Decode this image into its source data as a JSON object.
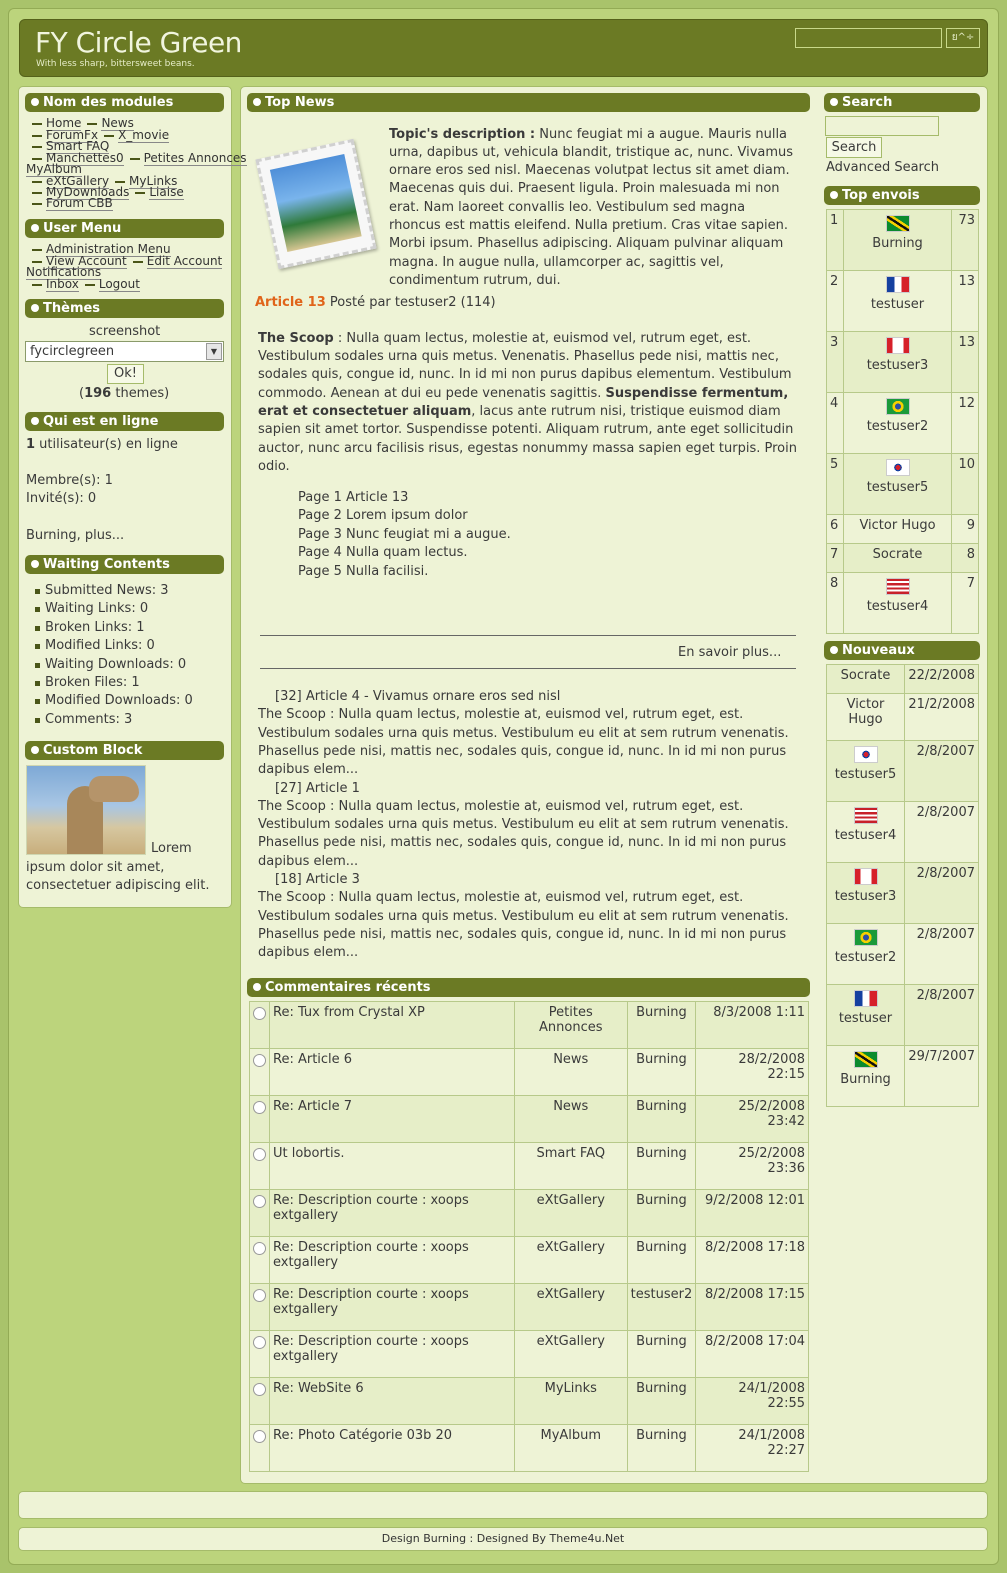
{
  "header": {
    "title": "FY Circle Green",
    "slogan": "With less sharp, bittersweet beans.",
    "search_button": "ย^÷"
  },
  "modules_block": {
    "title": "Nom des modules",
    "items": [
      "Home",
      "News",
      "ForumFx",
      "X_movie",
      "Smart FAQ",
      "Manchettes0",
      "Petites Annonces",
      "MyAlbum",
      "eXtGallery",
      "MyLinks",
      "MyDownloads",
      "Liaise",
      "Forum CBB"
    ]
  },
  "user_menu": {
    "title": "User Menu",
    "items": [
      "Administration Menu",
      "View Account",
      "Edit Account",
      "Notifications",
      "Inbox",
      "Logout"
    ]
  },
  "themes": {
    "title": "Thèmes",
    "screenshot_label": "screenshot",
    "selected": "fycirclegreen",
    "ok_button": "Ok!",
    "count_prefix": "(",
    "count": "196",
    "count_suffix": " themes)"
  },
  "online": {
    "title": "Qui est en ligne",
    "count": "1",
    "count_text": " utilisateur(s) en ligne",
    "members": "Membre(s): 1",
    "guests": "Invité(s): 0",
    "more": "Burning, plus..."
  },
  "waiting": {
    "title": "Waiting Contents",
    "items": [
      "Submitted News: 3",
      "Waiting Links: 0",
      "Broken Links: 1",
      "Modified Links: 0",
      "Waiting Downloads: 0",
      "Broken Files: 1",
      "Modified Downloads: 0",
      "Comments: 3"
    ]
  },
  "custom": {
    "title": "Custom Block",
    "text_1": "Lorem",
    "text_2": "ipsum dolor sit amet,",
    "text_3": "consectetuer adipiscing elit."
  },
  "top_news": {
    "title": "Top News",
    "topic_label": "Topic's description :",
    "topic_text": [
      " Nunc feugiat mi a augue. Mauris nulla",
      "urna, dapibus ut, vehicula blandit, tristique ac, nunc. Vivamus",
      "ornare eros sed nisl. Maecenas volutpat lectus sit amet diam.",
      "Maecenas quis dui. Praesent ligula. Proin malesuada mi non",
      "erat. Nam laoreet convallis leo. Vestibulum sed magna",
      "rhoncus est mattis eleifend. Nulla pretium. Cras vitae sapien.",
      "Morbi ipsum. Phasellus adipiscing. Aliquam pulvinar aliquam",
      "magna. In augue nulla, ullamcorper ac, sagittis vel,",
      "condimentum rutrum, dui."
    ],
    "article_label": "Article 13",
    "posted_by": " Posté par testuser2 (114)",
    "scoop_label": "The Scoop",
    "scoop_lines": [
      " : Nulla quam lectus, molestie at, euismod vel, rutrum eget, est.",
      "Vestibulum sodales urna quis metus. Venenatis. Phasellus pede nisi, mattis nec,",
      "sodales quis, congue id, nunc. In id mi non purus dapibus elementum. Vestibulum",
      "commodo. Aenean at dui eu pede venenatis sagittis. ",
      "lacus ante rutrum nisi, tristique euismod diam",
      "sapien sit amet tortor. Suspendisse potenti. Aliquam rutrum, ante eget sollicitudin",
      "auctor, nunc arcu facilisis risus, egestas nonummy massa sapien eget turpis. Proin",
      "odio."
    ],
    "scoop_bold_1": "Suspendisse fermentum,",
    "scoop_bold_2": "erat et consectetuer aliquam",
    "scoop_after_bold": ", lacus ante rutrum nisi, tristique euismod diam",
    "pages": [
      "Page 1 Article 13",
      "Page 2 Lorem ipsum dolor",
      "Page 3 Nunc feugiat mi a augue.",
      "Page 4 Nulla quam lectus.",
      "Page 5 Nulla facilisi."
    ],
    "read_more": "En savoir plus...",
    "others": [
      {
        "head": "[32] Article 4 - Vivamus ornare eros sed nisl",
        "lines": [
          "The Scoop : Nulla quam lectus, molestie at, euismod vel, rutrum eget, est.",
          "Vestibulum sodales urna quis metus. Vestibulum eu elit at sem rutrum venenatis.",
          "Phasellus pede nisi, mattis nec, sodales quis, congue id, nunc. In id mi non purus",
          "dapibus elem..."
        ]
      },
      {
        "head": "[27] Article 1",
        "lines": [
          "The Scoop : Nulla quam lectus, molestie at, euismod vel, rutrum eget, est.",
          "Vestibulum sodales urna quis metus. Vestibulum eu elit at sem rutrum venenatis.",
          "Phasellus pede nisi, mattis nec, sodales quis, congue id, nunc. In id mi non purus",
          "dapibus elem..."
        ]
      },
      {
        "head": "[18] Article 3",
        "lines": [
          "The Scoop : Nulla quam lectus, molestie at, euismod vel, rutrum eget, est.",
          "Vestibulum sodales urna quis metus. Vestibulum eu elit at sem rutrum venenatis.",
          "Phasellus pede nisi, mattis nec, sodales quis, congue id, nunc. In id mi non purus",
          "dapibus elem..."
        ]
      }
    ]
  },
  "comments": {
    "title": "Commentaires récents",
    "rows": [
      {
        "title": "Re: Tux from Crystal XP",
        "module": "Petites Annonces",
        "user": "Burning",
        "date": "8/3/2008 1:11",
        "icon": "circle"
      },
      {
        "title": "Re: Article 6",
        "module": "News",
        "user": "Burning",
        "date": "28/2/2008 22:15",
        "icon": "circle"
      },
      {
        "title": "Re: Article 7",
        "module": "News",
        "user": "Burning",
        "date": "25/2/2008 23:42",
        "icon": "circle"
      },
      {
        "title": "Ut lobortis.",
        "module": "Smart FAQ",
        "user": "Burning",
        "date": "25/2/2008 23:36",
        "icon": "circle"
      },
      {
        "title": "Re: Description courte : xoops extgallery",
        "module": "eXtGallery",
        "user": "Burning",
        "date": "9/2/2008 12:01",
        "icon": "smiley"
      },
      {
        "title": "Re: Description courte : xoops extgallery",
        "module": "eXtGallery",
        "user": "Burning",
        "date": "8/2/2008 17:18",
        "icon": "circle"
      },
      {
        "title": "Re: Description courte : xoops extgallery",
        "module": "eXtGallery",
        "user": "testuser2",
        "date": "8/2/2008 17:15",
        "icon": "circle"
      },
      {
        "title": "Re: Description courte : xoops extgallery",
        "module": "eXtGallery",
        "user": "Burning",
        "date": "8/2/2008 17:04",
        "icon": "circle"
      },
      {
        "title": "Re: WebSite 6",
        "module": "MyLinks",
        "user": "Burning",
        "date": "24/1/2008 22:55",
        "icon": "circle"
      },
      {
        "title": "Re: Photo Catégorie 03b 20",
        "module": "MyAlbum",
        "user": "Burning",
        "date": "24/1/2008 22:27",
        "icon": "circle"
      }
    ]
  },
  "search": {
    "title": "Search",
    "button": "Search",
    "advanced": "Advanced Search"
  },
  "top_posters": {
    "title": "Top envois",
    "rows": [
      {
        "rank": "1",
        "name": "Burning",
        "count": "73",
        "flag": "jamaica"
      },
      {
        "rank": "2",
        "name": "testuser",
        "count": "13",
        "flag": "france"
      },
      {
        "rank": "3",
        "name": "testuser3",
        "count": "13",
        "flag": "canada"
      },
      {
        "rank": "4",
        "name": "testuser2",
        "count": "12",
        "flag": "brazil"
      },
      {
        "rank": "5",
        "name": "testuser5",
        "count": "10",
        "flag": "korea"
      },
      {
        "rank": "6",
        "name": "Victor Hugo",
        "count": "9",
        "flag": ""
      },
      {
        "rank": "7",
        "name": "Socrate",
        "count": "8",
        "flag": ""
      },
      {
        "rank": "8",
        "name": "testuser4",
        "count": "7",
        "flag": "usa"
      }
    ]
  },
  "new_members": {
    "title": "Nouveaux",
    "rows": [
      {
        "name": "Socrate",
        "date": "22/2/2008",
        "flag": ""
      },
      {
        "name": "Victor Hugo",
        "date": "21/2/2008",
        "flag": ""
      },
      {
        "name": "testuser5",
        "date": "2/8/2007",
        "flag": "korea"
      },
      {
        "name": "testuser4",
        "date": "2/8/2007",
        "flag": "usa"
      },
      {
        "name": "testuser3",
        "date": "2/8/2007",
        "flag": "canada"
      },
      {
        "name": "testuser2",
        "date": "2/8/2007",
        "flag": "brazil"
      },
      {
        "name": "testuser",
        "date": "2/8/2007",
        "flag": "france"
      },
      {
        "name": "Burning",
        "date": "29/7/2007",
        "flag": "jamaica"
      }
    ]
  },
  "footer": {
    "text": "Design Burning : Designed By Theme4u.Net"
  },
  "colors": {
    "bar": "#6b7a24",
    "panel": "#eef3d6",
    "accent_orange": "#e0641a"
  }
}
